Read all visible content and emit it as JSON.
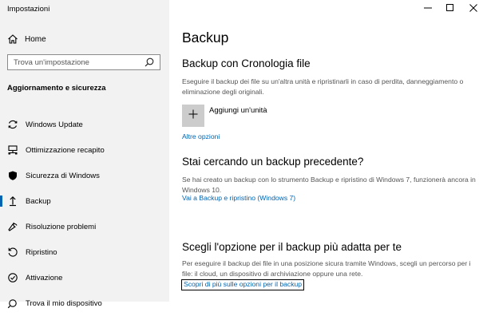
{
  "window": {
    "title": "Impostazioni",
    "controls": [
      "minimize",
      "maximize",
      "close"
    ]
  },
  "sidebar": {
    "home_label": "Home",
    "search_placeholder": "Trova un'impostazione",
    "section_title": "Aggiornamento e sicurezza",
    "items": [
      {
        "label": "Windows Update",
        "icon": "sync-icon",
        "active": false
      },
      {
        "label": "Ottimizzazione recapito",
        "icon": "delivery-optimization-icon",
        "active": false
      },
      {
        "label": "Sicurezza di Windows",
        "icon": "shield-icon",
        "active": false
      },
      {
        "label": "Backup",
        "icon": "backup-arrow-icon",
        "active": true
      },
      {
        "label": "Risoluzione problemi",
        "icon": "wrench-icon",
        "active": false
      },
      {
        "label": "Ripristino",
        "icon": "recovery-icon",
        "active": false
      },
      {
        "label": "Attivazione",
        "icon": "activation-check-icon",
        "active": false
      },
      {
        "label": "Trova il mio dispositivo",
        "icon": "find-device-icon",
        "active": false
      }
    ]
  },
  "main": {
    "title": "Backup",
    "file_history": {
      "heading": "Backup con Cronologia file",
      "description": "Eseguire il backup dei file su un'altra unità e ripristinarli in caso di perdita, danneggiamento o eliminazione degli originali.",
      "add_drive_label": "Aggiungi un'unità",
      "more_options_link": "Altre opzioni"
    },
    "older_backup": {
      "heading": "Stai cercando un backup precedente?",
      "description": "Se hai creato un backup con lo strumento Backup e ripristino di Windows 7, funzionerà ancora in Windows 10.",
      "link": "Vai a Backup e ripristino (Windows 7)"
    },
    "best_option": {
      "heading": "Scegli l'opzione per il backup più adatta per te",
      "description": "Per eseguire il backup dei file in una posizione sicura tramite Windows, scegli un percorso per i file: il cloud, un dispositivo di archiviazione oppure una rete.",
      "link": "Scopri di più sulle opzioni per il backup"
    }
  },
  "colors": {
    "sidebar_bg": "#f2f2f2",
    "accent": "#0063b1",
    "link": "#0063b1",
    "tile": "#cccccc",
    "desc_text": "#555555"
  }
}
